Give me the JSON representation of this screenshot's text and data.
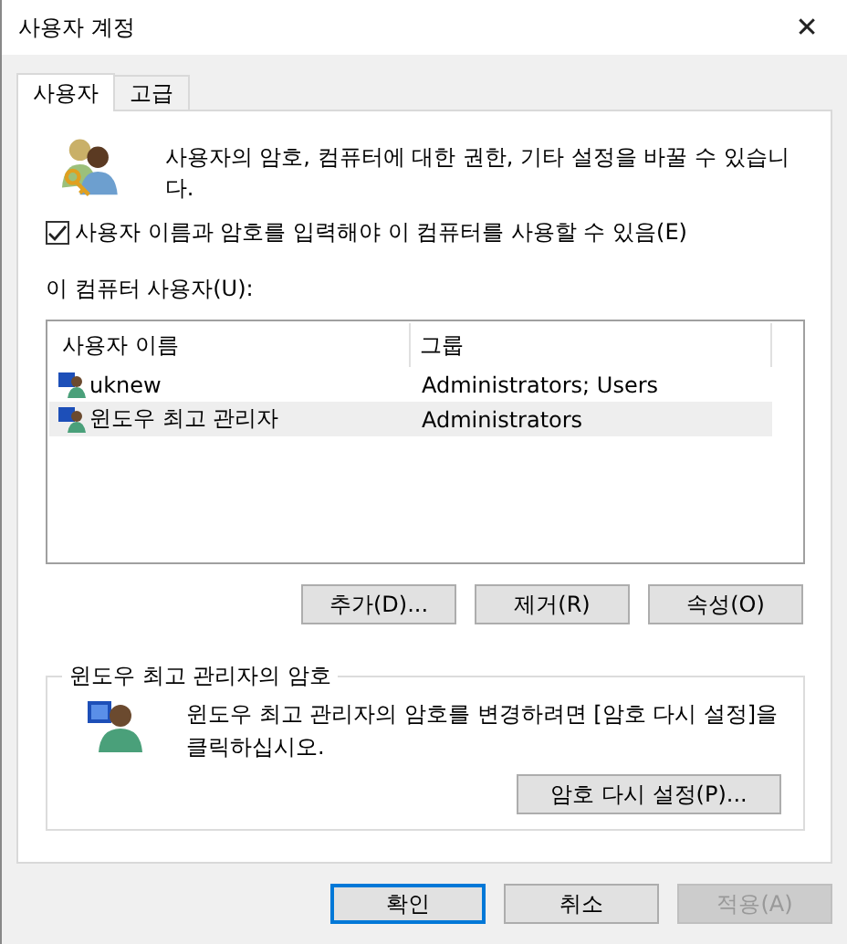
{
  "window": {
    "title": "사용자 계정",
    "close": "✕"
  },
  "tabs": [
    {
      "label": "사용자",
      "selected": true
    },
    {
      "label": "고급",
      "selected": false
    }
  ],
  "intro": "사용자의 암호, 컴퓨터에 대한 권한, 기타 설정을 바꿀 수 있습니다.",
  "require_password": {
    "label": "사용자 이름과 암호를 입력해야 이 컴퓨터를 사용할 수 있음(E)",
    "checked": true
  },
  "users_label": "이 컴퓨터 사용자(U):",
  "table": {
    "columns": [
      "사용자 이름",
      "그룹"
    ],
    "rows": [
      {
        "name": "uknew",
        "group": "Administrators; Users",
        "selected": false
      },
      {
        "name": "윈도우 최고 관리자",
        "group": "Administrators",
        "selected": true
      }
    ]
  },
  "list_buttons": [
    "추가(D)...",
    "제거(R)",
    "속성(O)"
  ],
  "password_group": {
    "title": "윈도우 최고 관리자의 암호",
    "text": "윈도우 최고 관리자의 암호를 변경하려면 [암호 다시 설정]을 클릭하십시오.",
    "button": "암호 다시 설정(P)..."
  },
  "dialog_buttons": [
    {
      "label": "확인",
      "default": true,
      "disabled": false
    },
    {
      "label": "취소",
      "default": false,
      "disabled": false
    },
    {
      "label": "적용(A)",
      "default": false,
      "disabled": true
    }
  ]
}
